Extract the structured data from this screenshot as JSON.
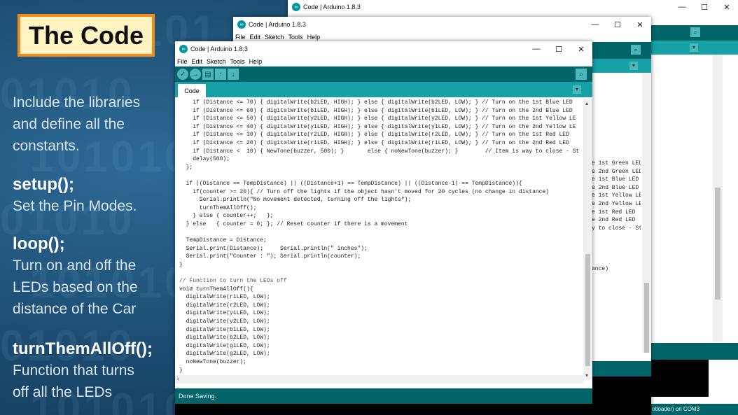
{
  "slide": {
    "title": "The Code",
    "sections": [
      {
        "heading": "",
        "text_lines": [
          "Include the libraries",
          "and define all the",
          "constants."
        ]
      },
      {
        "heading": "setup();",
        "text_lines": [
          "Set the Pin Modes."
        ]
      },
      {
        "heading": "loop();",
        "text_lines": [
          "Turn on and off the",
          "LEDs based on the",
          "distance of the Car"
        ]
      },
      {
        "heading": "turnThemAllOff();",
        "text_lines": [
          "Function that turns",
          "off all the LEDs"
        ]
      }
    ]
  },
  "windows": {
    "back": {
      "title": "Code | Arduino 1.8.3",
      "status": "otloader) on COM3"
    },
    "middle": {
      "title": "Code | Arduino 1.8.3",
      "menu": [
        "File",
        "Edit",
        "Sketch",
        "Tools",
        "Help"
      ]
    },
    "front": {
      "title": "Code | Arduino 1.8.3",
      "menu": [
        "File",
        "Edit",
        "Sketch",
        "Tools",
        "Help"
      ],
      "tab": "Code",
      "status": "Done Saving."
    }
  },
  "side_code_fragments": [
    "e 1st Green LED",
    "e 2nd Green LED",
    "e 1st Blue LED",
    "e 2nd Blue LED",
    "e 1st Yellow LE",
    "e 2nd Yellow LE",
    "e 1st Red LED",
    "e 2nd Red LED",
    "y to close - St",
    "",
    "",
    "",
    "",
    "ance)"
  ],
  "code_lines": [
    "    if (Distance <= 70) { digitalWrite(b2LED, HIGH); } else { digitalWrite(b2LED, LOW); } // Turn on the 1st Blue LED",
    "    if (Distance <= 60) { digitalWrite(b1LED, HIGH); } else { digitalWrite(b1LED, LOW); } // Turn on the 2nd Blue LED",
    "    if (Distance <= 50) { digitalWrite(y2LED, HIGH); } else { digitalWrite(y2LED, LOW); } // Turn on the 1st Yellow LE",
    "    if (Distance <= 40) { digitalWrite(y1LED, HIGH); } else { digitalWrite(y1LED, LOW); } // Turn on the 2nd Yellow LE",
    "    if (Distance <= 30) { digitalWrite(r2LED, HIGH); } else { digitalWrite(r2LED, LOW); } // Turn on the 1st Red LED",
    "    if (Distance <= 20) { digitalWrite(r1LED, HIGH); } else { digitalWrite(r1LED, LOW); } // Turn on the 2nd Red LED",
    "    if (Distance <  10) { NewTone(buzzer, 500); }       else { noNewTone(buzzer); }        // Item is way to close - St",
    "    delay(500);",
    "  };",
    "",
    "  if ((Distance == TempDistance) || ((Distance+1) == TempDistance) || ((Distance-1) == TempDistance)){",
    "    if(counter >= 20){ // Turn off the lights if the object hasn't moved for 20 cycles (no change in distance)",
    "      Serial.println(\"No movement detected, turning off the lights\");",
    "      turnThemAllOff();",
    "    } else { counter++;   };",
    "  } else   { counter = 0; }; // Reset counter if there is a movement",
    "",
    "  TempDistance = Distance;",
    "  Serial.print(Distance);     Serial.println(\" inches\");",
    "  Serial.print(\"Counter : \"); Serial.println(counter);",
    "}",
    "",
    "// Function to turn the LEDs off",
    "void turnThemAllOff(){",
    "  digitalWrite(r1LED, LOW);",
    "  digitalWrite(r2LED, LOW);",
    "  digitalWrite(y1LED, LOW);",
    "  digitalWrite(y2LED, LOW);",
    "  digitalWrite(b1LED, LOW);",
    "  digitalWrite(b2LED, LOW);",
    "  digitalWrite(g1LED, LOW);",
    "  digitalWrite(g2LED, LOW);",
    "  noNewTone(buzzer);",
    "}"
  ],
  "colors": {
    "toolbar": "#006468",
    "tabbar": "#17a1a5",
    "title_border": "#f08a1a",
    "title_fill": "#fff4c2"
  },
  "icons": [
    "verify-icon",
    "upload-icon",
    "new-icon",
    "open-icon",
    "save-icon",
    "serial-monitor-icon"
  ]
}
